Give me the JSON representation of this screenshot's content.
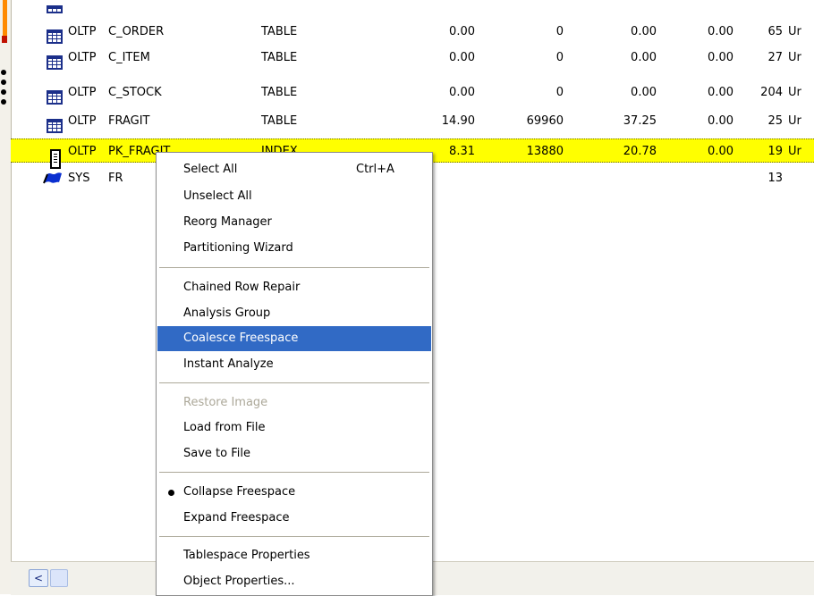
{
  "rows": [
    {
      "icon": "table-icon",
      "owner": "OLTP",
      "name": "C_ORDER",
      "type": "TABLE",
      "n1": "0.00",
      "n2": "0",
      "n3": "0.00",
      "n4": "0.00",
      "n5": "65",
      "unit": "Ur"
    },
    {
      "icon": "table-icon",
      "owner": "OLTP",
      "name": "C_ITEM",
      "type": "TABLE",
      "n1": "0.00",
      "n2": "0",
      "n3": "0.00",
      "n4": "0.00",
      "n5": "27",
      "unit": "Ur"
    },
    {
      "icon": "table-icon",
      "owner": "OLTP",
      "name": "C_STOCK",
      "type": "TABLE",
      "n1": "0.00",
      "n2": "0",
      "n3": "0.00",
      "n4": "0.00",
      "n5": "204",
      "unit": "Ur"
    },
    {
      "icon": "table-icon",
      "owner": "OLTP",
      "name": "FRAGIT",
      "type": "TABLE",
      "n1": "14.90",
      "n2": "69960",
      "n3": "37.25",
      "n4": "0.00",
      "n5": "25",
      "unit": "Ur"
    },
    {
      "icon": "index-icon",
      "owner": "OLTP",
      "name": "PK_FRAGIT",
      "type": "INDEX",
      "n1": "8.31",
      "n2": "13880",
      "n3": "20.78",
      "n4": "0.00",
      "n5": "19",
      "unit": "Ur",
      "selected": true
    },
    {
      "icon": "flag-icon",
      "owner": "SYS",
      "name": "FR",
      "type": "",
      "n1": "",
      "n2": "",
      "n3": "",
      "n4": "",
      "n5": "13",
      "unit": ""
    }
  ],
  "context_menu": {
    "items": [
      {
        "label": "Select All",
        "shortcut": "Ctrl+A"
      },
      {
        "label": "Unselect All"
      },
      {
        "label": "Reorg Manager"
      },
      {
        "label": "Partitioning Wizard"
      },
      {
        "label": "Chained Row Repair"
      },
      {
        "label": "Analysis Group"
      },
      {
        "label": "Coalesce Freespace",
        "highlighted": true
      },
      {
        "label": "Instant Analyze"
      },
      {
        "label": "Restore Image",
        "disabled": true
      },
      {
        "label": "Load from File"
      },
      {
        "label": "Save to File"
      },
      {
        "label": "Collapse Freespace",
        "checked": true
      },
      {
        "label": "Expand Freespace"
      },
      {
        "label": "Tablespace Properties"
      },
      {
        "label": "Object Properties..."
      }
    ]
  },
  "scrollbar": {
    "left_arrow": "<"
  },
  "colors": {
    "selected_row": "#ffff00",
    "menu_highlight": "#316ac5",
    "disabled_text": "#aca899"
  }
}
